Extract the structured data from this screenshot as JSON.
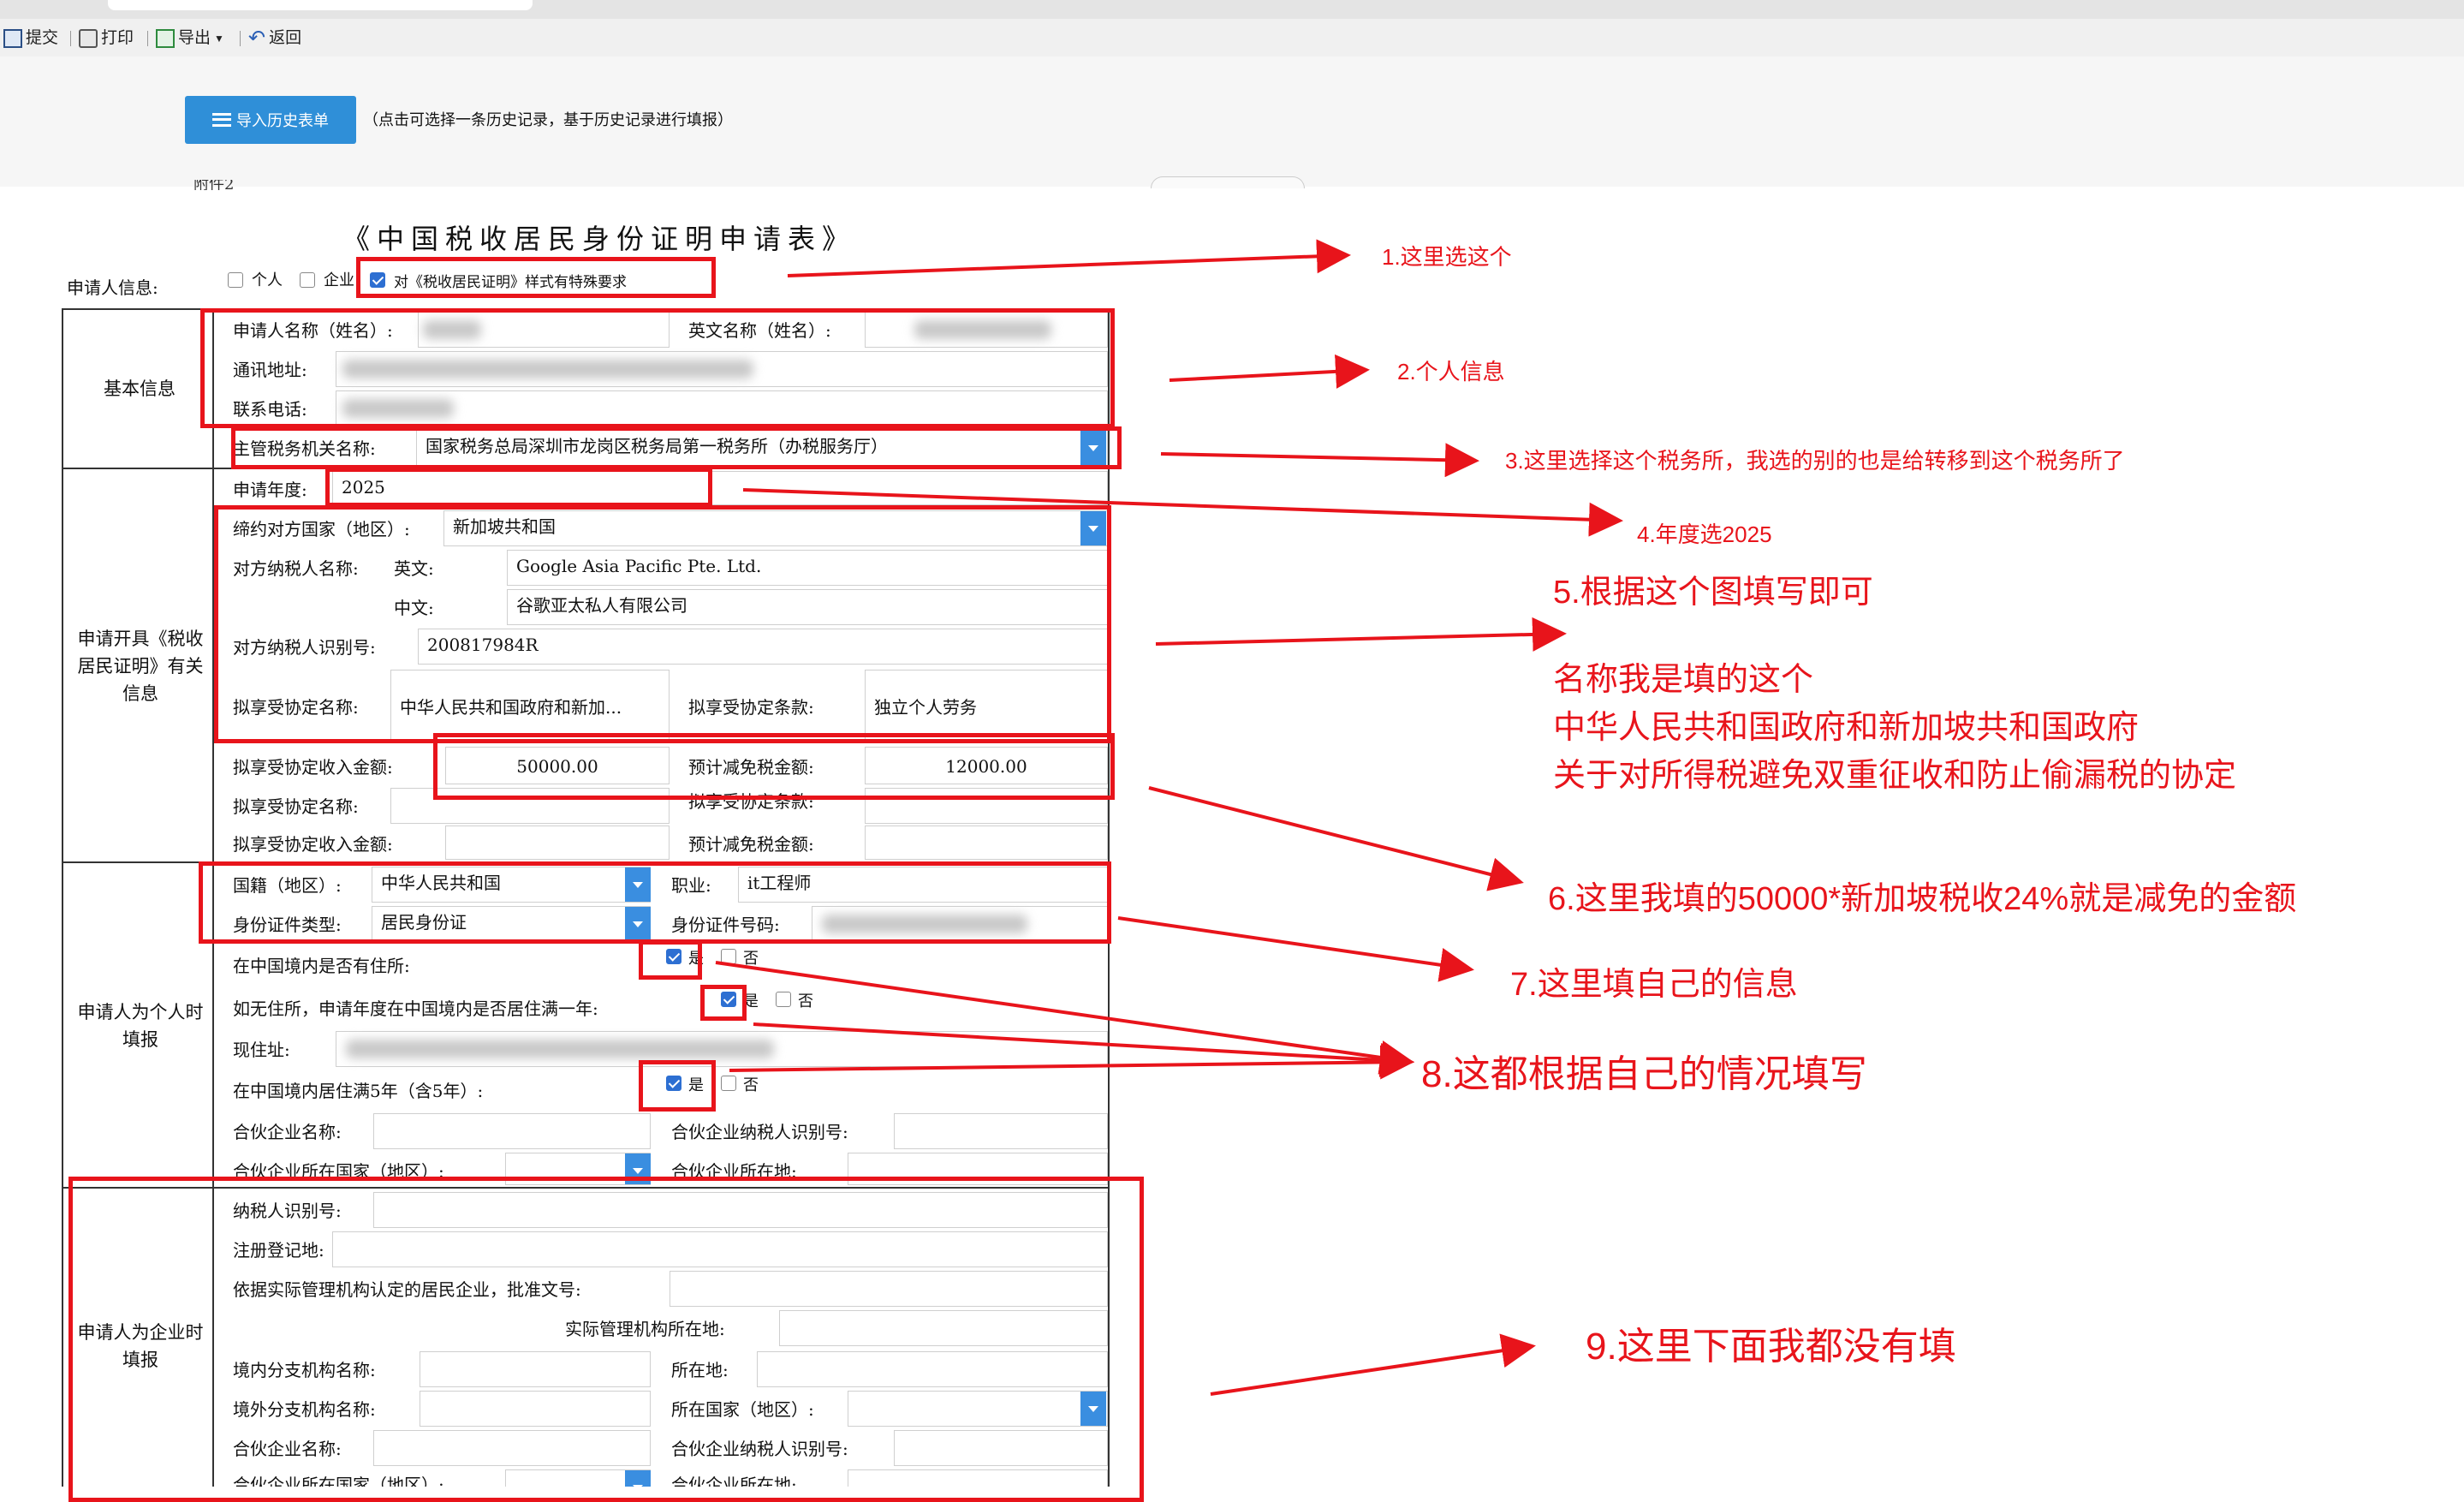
{
  "toolbar": {
    "submit": "提交",
    "print": "打印",
    "export": "导出",
    "back": "返回"
  },
  "import": {
    "button": "导入历史表单",
    "note": "（点击可选择一条历史记录，基于历史记录进行填报）"
  },
  "attachment_label": "附件2",
  "form": {
    "title": "《中国税收居民身份证明申请表》",
    "applicant_info_label": "申请人信息:",
    "type_options": {
      "individual": "个人",
      "enterprise": "企业",
      "special": "对《税收居民证明》样式有特殊要求"
    },
    "sections": {
      "basic": "基本信息",
      "cert": "申请开具《税收居民证明》有关信息",
      "individual": "申请人为个人时填报",
      "enterprise": "申请人为企业时填报"
    },
    "basic": {
      "name_label": "申请人名称（姓名）:",
      "en_name_label": "英文名称（姓名）:",
      "address_label": "通讯地址:",
      "phone_label": "联系电话:",
      "tax_office_label": "主管税务机关名称:",
      "tax_office_value": "国家税务总局深圳市龙岗区税务局第一税务所（办税服务厅）"
    },
    "cert": {
      "year_label": "申请年度:",
      "year_value": "2025",
      "country_label": "缔约对方国家（地区）:",
      "country_value": "新加坡共和国",
      "counterparty_label": "对方纳税人名称:",
      "en_label": "英文:",
      "en_value": "Google Asia Pacific Pte. Ltd.",
      "cn_label": "中文:",
      "cn_value": "谷歌亚太私人有限公司",
      "tin_label": "对方纳税人识别号:",
      "tin_value": "200817984R",
      "treaty_name_label": "拟享受协定名称:",
      "treaty_name_value": "中华人民共和国政府和新加...",
      "treaty_article_label": "拟享受协定条款:",
      "treaty_article_value": "独立个人劳务",
      "income_label": "拟享受协定收入金额:",
      "income_value": "50000.00",
      "exempt_label": "预计减免税金额:",
      "exempt_value": "12000.00",
      "treaty_name_label2": "拟享受协定名称:",
      "treaty_article_label2": "拟享受协定条款:",
      "income_label2": "拟享受协定收入金额:",
      "exempt_label2": "预计减免税金额:"
    },
    "individual": {
      "nationality_label": "国籍（地区）:",
      "nationality_value": "中华人民共和国",
      "occupation_label": "职业:",
      "occupation_value": "it工程师",
      "id_type_label": "身份证件类型:",
      "id_type_value": "居民身份证",
      "id_no_label": "身份证件号码:",
      "residence_q": "在中国境内是否有住所:",
      "no_residence_q": "如无住所，申请年度在中国境内是否居住满一年:",
      "current_address_label": "现住址:",
      "five_years_q": "在中国境内居住满5年（含5年）:",
      "yes": "是",
      "no": "否",
      "partner_name_label": "合伙企业名称:",
      "partner_tin_label": "合伙企业纳税人识别号:",
      "partner_country_label": "合伙企业所在国家（地区）:",
      "partner_location_label": "合伙企业所在地:"
    },
    "enterprise": {
      "tin_label": "纳税人识别号:",
      "reg_label": "注册登记地:",
      "approval_label": "依据实际管理机构认定的居民企业，批准文号:",
      "mgmt_location_label": "实际管理机构所在地:",
      "domestic_branch_label": "境内分支机构名称:",
      "location_label": "所在地:",
      "foreign_branch_label": "境外分支机构名称:",
      "country_label": "所在国家（地区）:",
      "partner_name_label": "合伙企业名称:",
      "partner_tin_label": "合伙企业纳税人识别号:",
      "partner_country_label": "合伙企业所在国家（地区）:",
      "partner_location_label": "合伙企业所在地:"
    }
  },
  "annotations": {
    "n1": "1.这里选这个",
    "n2": "2.个人信息",
    "n3": "3.这里选择这个税务所，我选的别的也是给转移到这个税务所了",
    "n4": "4.年度选2025",
    "n5": "5.根据这个图填写即可",
    "n5_line1": "名称我是填的这个",
    "n5_line2": "中华人民共和国政府和新加坡共和国政府",
    "n5_line3": "关于对所得税避免双重征收和防止偷漏税的协定",
    "n6": "6.这里我填的50000*新加坡税收24%就是减免的金额",
    "n7": "7.这里填自己的信息",
    "n8": "8.这都根据自己的情况填写",
    "n9": "9.这里下面我都没有填"
  },
  "colors": {
    "annotation_red": "#e8141b",
    "button_blue": "#2f8fd8",
    "checkbox_blue": "#2d6fd2"
  }
}
